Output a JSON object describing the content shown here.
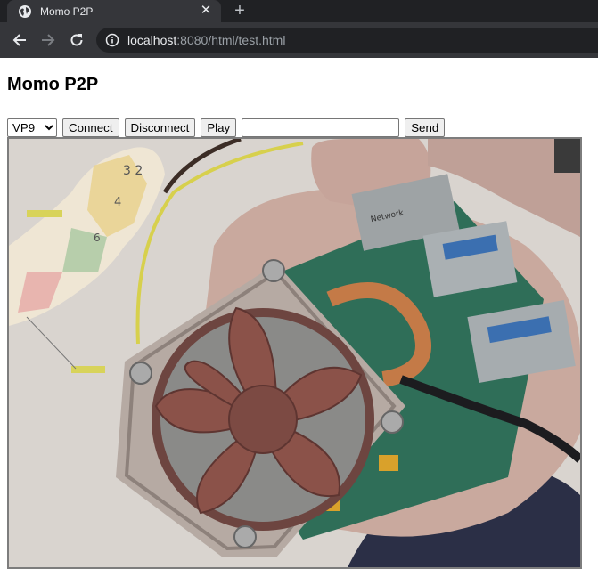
{
  "browser": {
    "tab": {
      "title": "Momo P2P",
      "close_glyph": "✕",
      "favicon": "globe-icon"
    },
    "new_tab_glyph": "+",
    "address": {
      "host": "localhost",
      "rest": ":8080/html/test.html"
    }
  },
  "page": {
    "title": "Momo P2P",
    "codec": {
      "selected": "VP9",
      "options": [
        "VP9"
      ]
    },
    "buttons": {
      "connect": "Connect",
      "disconnect": "Disconnect",
      "play": "Play",
      "send": "Send"
    },
    "message_input": {
      "value": "",
      "placeholder": ""
    }
  },
  "video": {
    "description_icon": "remote-video-stream",
    "colors": {
      "wall": "#d9d4cf",
      "fan": "#7e4a44",
      "board": "#2f6e58",
      "copper": "#c47a47"
    }
  }
}
